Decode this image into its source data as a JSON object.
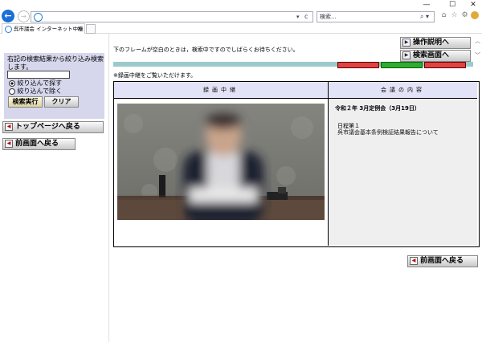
{
  "browser": {
    "search_placeholder": "検索...",
    "tab_title": "呉市議会 インターネット中継",
    "window_buttons": {
      "minimize": "—",
      "maximize": "☐",
      "close": "✕"
    },
    "address_dropdown": "▾",
    "refresh_glyph": "c",
    "search_glyph": "⌕ ▾"
  },
  "sidebar": {
    "filter_text": "右記の検索結果から絞り込み検索します。",
    "filter_input_value": "",
    "option_include": "絞り込んで探す",
    "option_exclude": "絞り込んで除く",
    "search_button": "検索実行",
    "clear_button": "クリア",
    "top_page_button": "トップページへ戻る",
    "prev_page_button": "前画面へ戻る"
  },
  "main": {
    "notice": "下のフレームが空白のときは，検索中ですのでしばらくお待ちください。",
    "help_button": "操作説明へ",
    "search_screen_button": "検索画面へ",
    "recording_note": "※録画中継をご覧いただけます。",
    "table_header_left": "録画中継",
    "table_header_right": "会議の内容",
    "meeting_title": "令和２年 3月定例会（3月19日）",
    "agenda_day": "日程第１",
    "agenda_item": "呉市議会基本条例検証結果報告について",
    "prev_page_button": "前画面へ戻る"
  },
  "colors": {
    "header_bg": "#e3e3f7",
    "panel_bg": "#d6d6ec",
    "accent_blue": "#1b6fd6"
  }
}
